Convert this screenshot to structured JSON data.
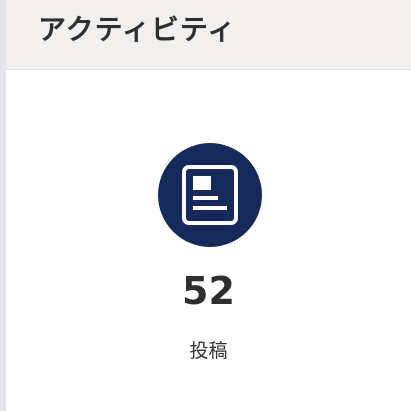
{
  "card": {
    "title": "アクティビティ",
    "stat": {
      "icon": "article-icon",
      "value": "52",
      "label": "投稿"
    }
  },
  "colors": {
    "icon_background": "#15295a",
    "header_background": "#f1f0ee",
    "page_background": "#e3e5e8"
  }
}
